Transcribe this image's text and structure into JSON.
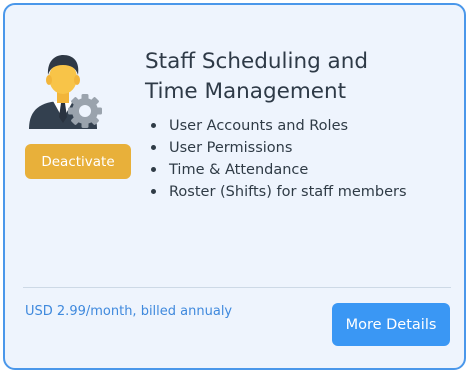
{
  "card": {
    "title_line1": "Staff Scheduling and",
    "title_line2": "Time Management",
    "features": [
      "User Accounts and Roles",
      "User Permissions",
      "Time & Attendance",
      "Roster (Shifts) for staff members"
    ],
    "deactivate_label": "Deactivate",
    "price_text": "USD 2.99/month, billed annualy",
    "details_label": "More Details",
    "icon": "staff-manager-gear-icon"
  },
  "colors": {
    "border": "#4a97ea",
    "background": "#eef4fd",
    "deactivate": "#e8b03a",
    "details": "#3a97f4",
    "price": "#3f89dd"
  }
}
